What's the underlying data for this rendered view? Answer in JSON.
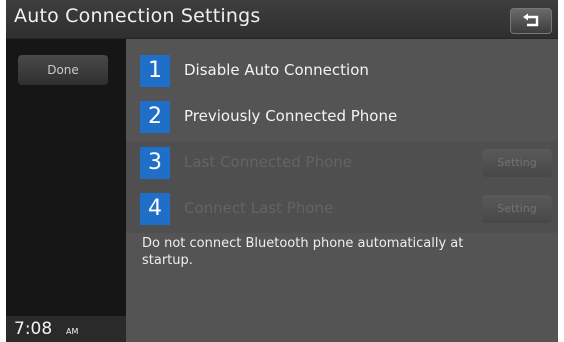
{
  "header": {
    "title": "Auto Connection Settings",
    "back_icon": "back-arrow-icon"
  },
  "sidebar": {
    "done_label": "Done"
  },
  "options": [
    {
      "number": "1",
      "label": "Disable Auto Connection",
      "enabled": true
    },
    {
      "number": "2",
      "label": "Previously Connected Phone",
      "enabled": true
    },
    {
      "number": "3",
      "label": "Last Connected Phone",
      "enabled": false,
      "button": "Setting"
    },
    {
      "number": "4",
      "label": "Connect Last Phone",
      "enabled": false,
      "button": "Setting"
    }
  ],
  "description": "Do not connect Bluetooth phone automatically at startup.",
  "clock": {
    "time": "7:08",
    "ampm": "AM"
  },
  "colors": {
    "number_badge": "#1f6ec8",
    "background": "#545454"
  }
}
